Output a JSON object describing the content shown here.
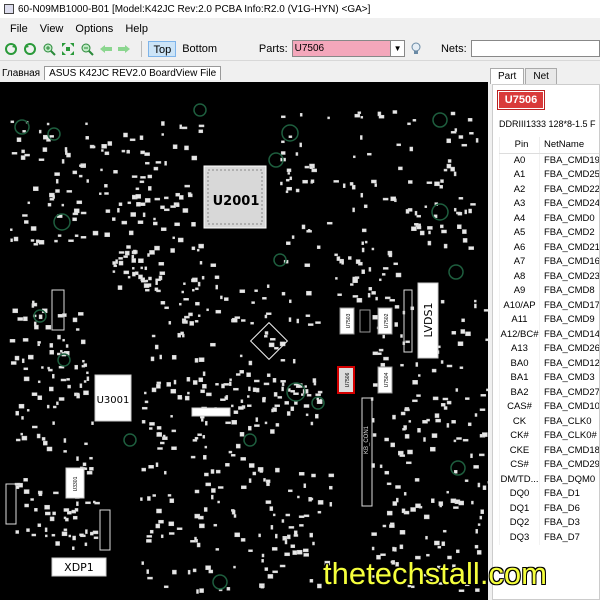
{
  "window": {
    "title": "60-N09MB1000-B01 [Model:K42JC Rev:2.0 PCBA Info:R2.0 (V1G-HYN) <GA>]"
  },
  "menu": {
    "items": [
      "File",
      "View",
      "Options",
      "Help"
    ]
  },
  "toolbar": {
    "icons": [
      "refresh-icon",
      "refresh-back-icon",
      "zoom-in-icon",
      "fit-icon",
      "zoom-out-icon",
      "arrow-left-icon",
      "arrow-right-icon"
    ],
    "top_label": "Top",
    "bottom_label": "Bottom",
    "parts_label": "Parts:",
    "parts_value": "U7506",
    "nets_label": "Nets:",
    "nets_value": ""
  },
  "doc": {
    "label": "Главная",
    "tab": "ASUS K42JC REV2.0 BoardView File"
  },
  "board": {
    "labels": [
      "U2001",
      "U3001",
      "LVDS1",
      "XDP1",
      "U7503",
      "U7502",
      "U7505",
      "U7506",
      "U7504",
      "U3301",
      "KB_CON1"
    ],
    "selected": "U7506"
  },
  "panel": {
    "tabs": [
      "Part",
      "Net"
    ],
    "active_tab": "Part",
    "part_name": "U7506",
    "part_desc": "DDRIII1333 128*8-1.5 F",
    "columns": [
      "Pin",
      "NetName"
    ],
    "rows": [
      {
        "pin": "A0",
        "net": "FBA_CMD19"
      },
      {
        "pin": "A1",
        "net": "FBA_CMD25"
      },
      {
        "pin": "A2",
        "net": "FBA_CMD22"
      },
      {
        "pin": "A3",
        "net": "FBA_CMD24"
      },
      {
        "pin": "A4",
        "net": "FBA_CMD0"
      },
      {
        "pin": "A5",
        "net": "FBA_CMD2"
      },
      {
        "pin": "A6",
        "net": "FBA_CMD21"
      },
      {
        "pin": "A7",
        "net": "FBA_CMD16"
      },
      {
        "pin": "A8",
        "net": "FBA_CMD23"
      },
      {
        "pin": "A9",
        "net": "FBA_CMD8"
      },
      {
        "pin": "A10/AP",
        "net": "FBA_CMD17"
      },
      {
        "pin": "A11",
        "net": "FBA_CMD9"
      },
      {
        "pin": "A12/BC#",
        "net": "FBA_CMD14"
      },
      {
        "pin": "A13",
        "net": "FBA_CMD26"
      },
      {
        "pin": "BA0",
        "net": "FBA_CMD12"
      },
      {
        "pin": "BA1",
        "net": "FBA_CMD3"
      },
      {
        "pin": "BA2",
        "net": "FBA_CMD27"
      },
      {
        "pin": "CAS#",
        "net": "FBA_CMD10"
      },
      {
        "pin": "CK",
        "net": "FBA_CLK0"
      },
      {
        "pin": "CK#",
        "net": "FBA_CLK0#"
      },
      {
        "pin": "CKE",
        "net": "FBA_CMD18"
      },
      {
        "pin": "CS#",
        "net": "FBA_CMD29"
      },
      {
        "pin": "DM/TD...",
        "net": "FBA_DQM0"
      },
      {
        "pin": "DQ0",
        "net": "FBA_D1"
      },
      {
        "pin": "DQ1",
        "net": "FBA_D6"
      },
      {
        "pin": "DQ2",
        "net": "FBA_D3"
      },
      {
        "pin": "DQ3",
        "net": "FBA_D7"
      }
    ]
  },
  "watermark": "thetechstall.com",
  "colors": {
    "parts_field": "#f4a7bb",
    "part_badge": "#d93a3a",
    "board_bg": "#000000",
    "watermark": "#f5ff3c"
  }
}
